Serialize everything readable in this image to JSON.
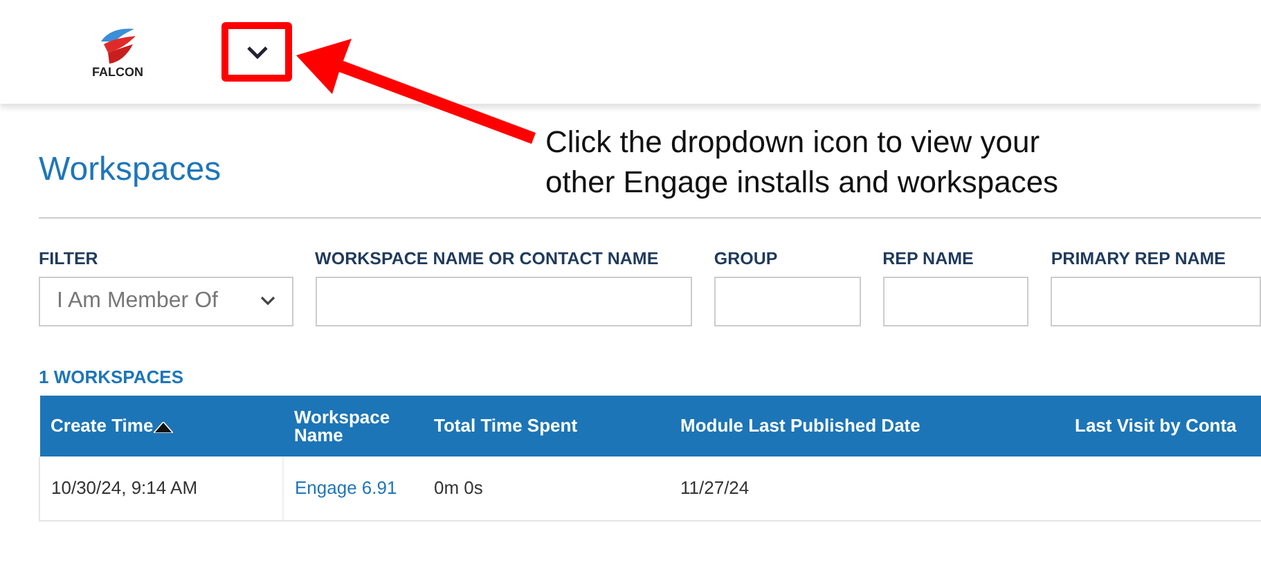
{
  "header": {
    "logo_text": "FALCON"
  },
  "callout": {
    "text": "Click the dropdown icon to view your other Engage installs and workspaces"
  },
  "page_title": "Workspaces",
  "filters": [
    {
      "kind": "select",
      "label": "FILTER",
      "value": "I Am Member Of"
    },
    {
      "kind": "text",
      "label": "WORKSPACE NAME OR CONTACT NAME"
    },
    {
      "kind": "text",
      "label": "GROUP"
    },
    {
      "kind": "text",
      "label": "REP NAME"
    },
    {
      "kind": "text",
      "label": "PRIMARY REP NAME"
    }
  ],
  "result_count": "1 WORKSPACES",
  "table": {
    "columns": [
      {
        "label": "Create Time",
        "sorted": true
      },
      {
        "label": "Workspace Name",
        "sorted": false
      },
      {
        "label": "Total Time Spent",
        "sorted": false
      },
      {
        "label": "Module Last Published Date",
        "sorted": false
      },
      {
        "label": "Last Visit by Conta",
        "sorted": false
      }
    ],
    "rows": [
      [
        "10/30/24, 9:14 AM",
        "Engage 6.91",
        "0m 0s",
        "11/27/24",
        ""
      ]
    ]
  }
}
